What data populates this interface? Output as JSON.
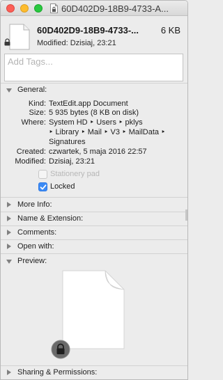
{
  "window": {
    "title": "60D402D9-18B9-4733-A..."
  },
  "header": {
    "file_name": "60D402D9-18B9-4733-...",
    "file_size": "6 KB",
    "modified": "Modified: Dzisiaj, 23:21"
  },
  "tags": {
    "placeholder": "Add Tags..."
  },
  "sections": {
    "general": "General:",
    "more_info": "More Info:",
    "name_extension": "Name & Extension:",
    "comments": "Comments:",
    "open_with": "Open with:",
    "preview": "Preview:",
    "sharing": "Sharing & Permissions:"
  },
  "general": {
    "kind_label": "Kind:",
    "kind_value": "TextEdit.app Document",
    "size_label": "Size:",
    "size_value": "5 935 bytes (8 KB on disk)",
    "where_label": "Where:",
    "where_line1": "System HD ‣ Users ‣ pklys",
    "where_line2": "‣ Library ‣ Mail ‣ V3 ‣ MailData ‣",
    "where_line3": "Signatures",
    "created_label": "Created:",
    "created_value": "czwartek, 5 maja 2016 22:57",
    "modified_label": "Modified:",
    "modified_value": "Dzisiaj, 23:21",
    "stationery_label": "Stationery pad",
    "locked_label": "Locked",
    "locked_checked": true,
    "stationery_checked": false
  },
  "colors": {
    "accent": "#3b8af5",
    "close": "#fc5f57",
    "minimize": "#fdbc2e",
    "zoom": "#29c840"
  }
}
